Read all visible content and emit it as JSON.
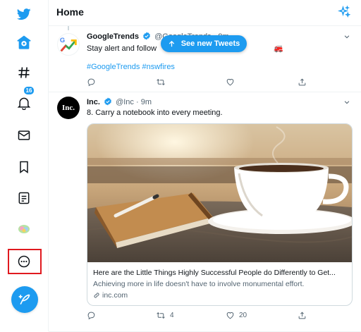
{
  "colors": {
    "accent": "#1d9bf0",
    "highlight": "#e0191f"
  },
  "sidebar": {
    "items": [
      {
        "name": "logo",
        "icon": "bird-logo-icon"
      },
      {
        "name": "home",
        "icon": "home-icon"
      },
      {
        "name": "explore",
        "icon": "hashtag-icon"
      },
      {
        "name": "notifications",
        "icon": "bell-icon",
        "badge": "16"
      },
      {
        "name": "messages",
        "icon": "mail-icon"
      },
      {
        "name": "bookmarks",
        "icon": "bookmark-icon"
      },
      {
        "name": "lists",
        "icon": "list-icon"
      },
      {
        "name": "profile",
        "icon": "avatar-icon"
      },
      {
        "name": "more",
        "icon": "more-circle-icon"
      }
    ],
    "compose_icon": "feather-plus-icon"
  },
  "header": {
    "title": "Home",
    "sparkle_icon": "sparkle-icon"
  },
  "new_tweets": {
    "label": "See new Tweets",
    "icon": "arrow-up-icon"
  },
  "tweets": [
    {
      "name": "GoogleTrends",
      "handle": "@GoogleTrends",
      "time": "9m",
      "text_start": "Stay alert and follow",
      "text_end": "🚒",
      "hashtags": "#GoogleTrends #nswfires",
      "reply_count": "",
      "retweet_count": "",
      "like_count": ""
    },
    {
      "name": "Inc.",
      "handle": "@Inc",
      "time": "9m",
      "text": "8. Carry a notebook into every meeting.",
      "avatar_text": "Inc.",
      "card": {
        "title": "Here are the Little Things Highly Successful People do Differently to Get...",
        "description": "Achieving more in life doesn't have to involve monumental effort.",
        "domain": "inc.com"
      },
      "reply_count": "",
      "retweet_count": "4",
      "like_count": "20"
    }
  ]
}
